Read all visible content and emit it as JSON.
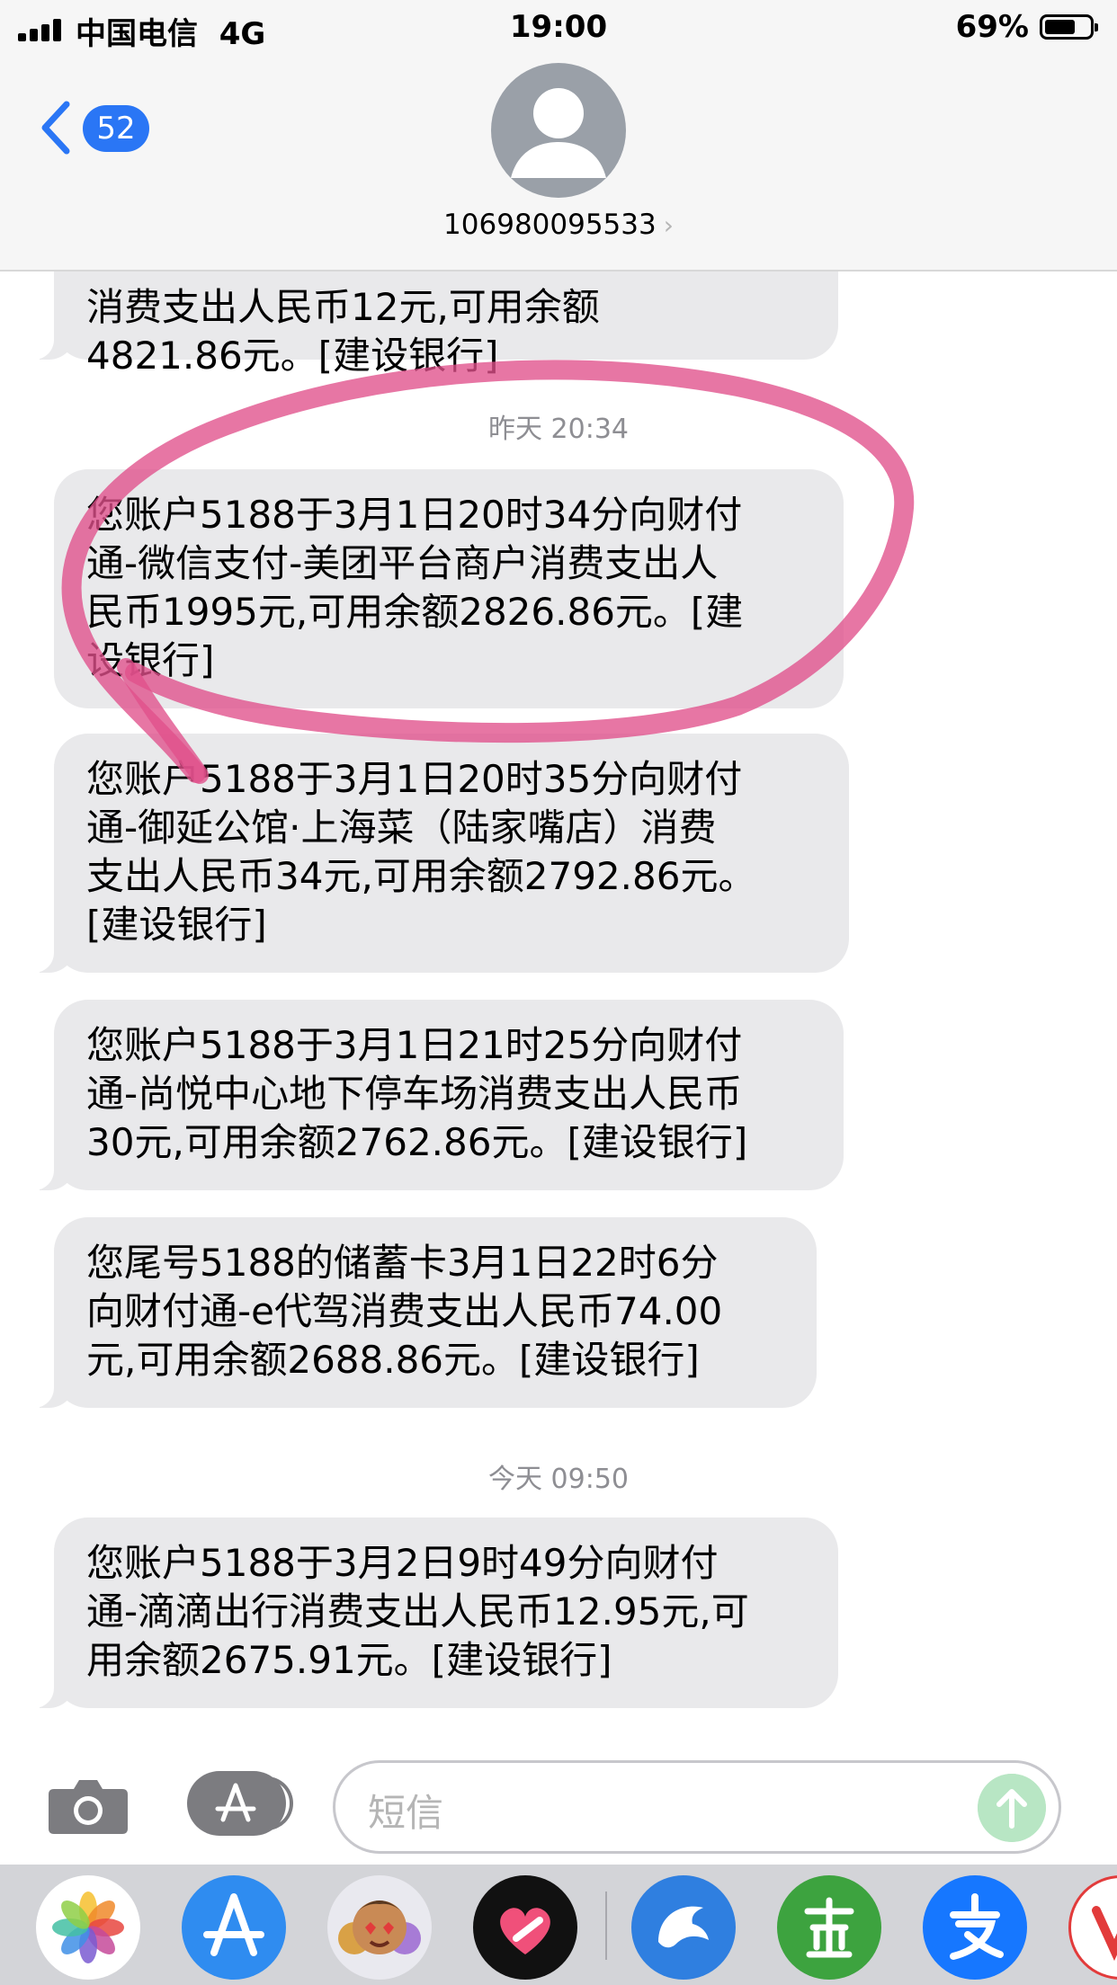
{
  "status_bar": {
    "carrier": "中国电信",
    "network": "4G",
    "time": "19:00",
    "battery_percent": "69%",
    "battery_level": 0.69
  },
  "header": {
    "back_badge": "52",
    "contact_number": "106980095533",
    "contact_chevron": "›"
  },
  "messages": [
    {
      "text": "消费支出人民币12元,可用余额\n4821.86元。[建设银行]"
    },
    {
      "timestamp": "昨天 20:34"
    },
    {
      "text": "您账户5188于3月1日20时34分向财付\n通-微信支付-美团平台商户消费支出人\n民币1995元,可用余额2826.86元。[建\n设银行]"
    },
    {
      "text": "您账户5188于3月1日20时35分向财付\n通-御延公馆·上海菜（陆家嘴店）消费\n支出人民币34元,可用余额2792.86元。\n[建设银行]"
    },
    {
      "text": "您账户5188于3月1日21时25分向财付\n通-尚悦中心地下停车场消费支出人民币\n30元,可用余额2762.86元。[建设银行]"
    },
    {
      "text": "您尾号5188的储蓄卡3月1日22时6分\n向财付通-e代驾消费支出人民币74.00\n元,可用余额2688.86元。[建设银行]"
    },
    {
      "timestamp": "今天 09:50"
    },
    {
      "text": "您账户5188于3月2日9时49分向财付\n通-滴滴出行消费支出人民币12.95元,可\n用余额2675.91元。[建设银行]"
    }
  ],
  "input": {
    "placeholder": "短信"
  },
  "app_drawer": [
    {
      "icon": "photos-icon"
    },
    {
      "icon": "app-store-icon"
    },
    {
      "icon": "memoji-icon"
    },
    {
      "icon": "heart-app-icon"
    },
    {
      "icon": "ctrip-dolphin-icon"
    },
    {
      "icon": "green-app-icon"
    },
    {
      "icon": "alipay-icon"
    },
    {
      "icon": "partial-app-icon"
    }
  ],
  "colors": {
    "badge_blue": "#2a76f5",
    "bubble_gray": "#e9e9eb",
    "annotation_pink": "#e0508a"
  }
}
